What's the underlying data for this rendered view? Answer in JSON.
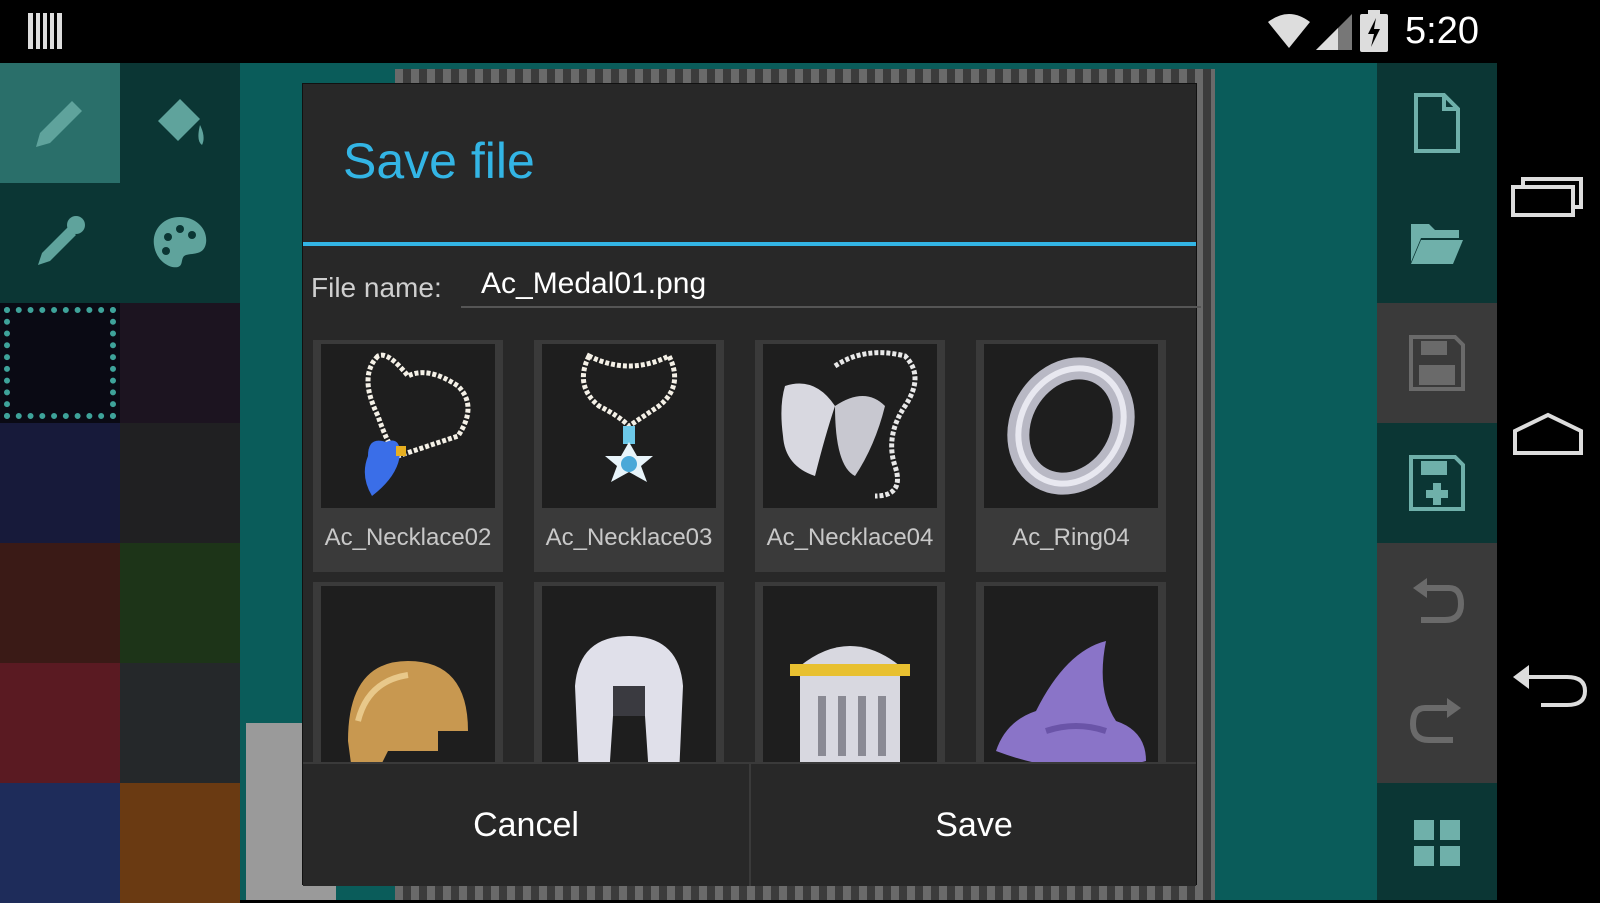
{
  "status_bar": {
    "time": "5:20",
    "icons": [
      "notification-icon",
      "wifi-icon",
      "signal-icon",
      "battery-charging-icon"
    ]
  },
  "toolbar": {
    "tools": [
      "pencil-icon",
      "paint-bucket-icon",
      "eyedropper-icon",
      "palette-icon"
    ]
  },
  "palette": {
    "colors": [
      "#0a0a14",
      "#1c1420",
      "#171a3a",
      "#202022",
      "#3a1a16",
      "#1d3418",
      "#5a1a22",
      "#25282a",
      "#1e2c5a",
      "#6a3a12"
    ]
  },
  "right_toolbar": {
    "buttons": [
      "new-file-icon",
      "open-folder-icon",
      "save-icon",
      "save-as-icon",
      "undo-icon",
      "redo-icon",
      "grid-icon"
    ]
  },
  "nav_bar": {
    "buttons": [
      "recent-apps-icon",
      "home-icon",
      "back-icon"
    ]
  },
  "dialog": {
    "title": "Save file",
    "file_name_label": "File name:",
    "file_name_value": "Ac_Medal01.png",
    "files": [
      {
        "name": "Ac_Necklace02",
        "icon": "necklace-heart-icon"
      },
      {
        "name": "Ac_Necklace03",
        "icon": "necklace-star-icon"
      },
      {
        "name": "Ac_Necklace04",
        "icon": "necklace-wings-icon"
      },
      {
        "name": "Ac_Ring04",
        "icon": "ring-icon"
      },
      {
        "name": "",
        "icon": "bronze-helmet-icon"
      },
      {
        "name": "",
        "icon": "steel-helmet-icon"
      },
      {
        "name": "",
        "icon": "knight-helmet-icon"
      },
      {
        "name": "",
        "icon": "wizard-hat-icon"
      }
    ],
    "cancel_label": "Cancel",
    "save_label": "Save"
  },
  "colors": {
    "accent": "#33b5e5",
    "app_bg": "#0a5c5a",
    "dialog_bg": "#282828"
  }
}
